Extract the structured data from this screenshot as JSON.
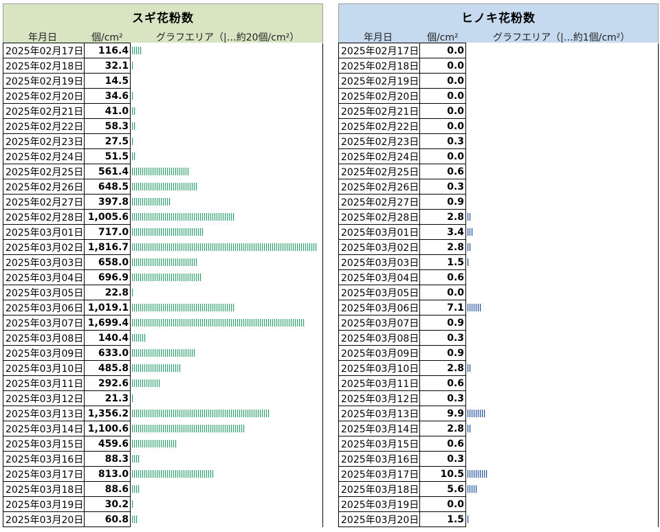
{
  "left": {
    "title": "スギ花粉数",
    "col_date": "年月日",
    "col_value": "個/cm²",
    "col_graph": "グラフエリア（|…約20個/cm²）",
    "header_color": "#d9e5c2",
    "bar_color": "#2e9e6e"
  },
  "right": {
    "title": "ヒノキ花粉数",
    "col_date": "年月日",
    "col_value": "個/cm²",
    "col_graph": "グラフエリア（|…約1個/cm²）",
    "header_color": "#c5d9ef",
    "bar_color": "#1f4e9c"
  },
  "chart_data": [
    {
      "type": "bar",
      "title": "スギ花粉数",
      "unit": "個/cm²",
      "tick_unit": 20,
      "categories": [
        "2025年02月17日",
        "2025年02月18日",
        "2025年02月19日",
        "2025年02月20日",
        "2025年02月21日",
        "2025年02月22日",
        "2025年02月23日",
        "2025年02月24日",
        "2025年02月25日",
        "2025年02月26日",
        "2025年02月27日",
        "2025年02月28日",
        "2025年03月01日",
        "2025年03月02日",
        "2025年03月03日",
        "2025年03月04日",
        "2025年03月05日",
        "2025年03月06日",
        "2025年03月07日",
        "2025年03月08日",
        "2025年03月09日",
        "2025年03月10日",
        "2025年03月11日",
        "2025年03月12日",
        "2025年03月13日",
        "2025年03月14日",
        "2025年03月15日",
        "2025年03月16日",
        "2025年03月17日",
        "2025年03月18日",
        "2025年03月19日",
        "2025年03月20日"
      ],
      "values": [
        116.4,
        32.1,
        14.5,
        34.6,
        41.0,
        58.3,
        27.5,
        51.5,
        561.4,
        648.5,
        397.8,
        1005.6,
        717.0,
        1816.7,
        658.0,
        696.9,
        22.8,
        1019.1,
        1699.4,
        140.4,
        633.0,
        485.8,
        292.6,
        21.3,
        1356.2,
        1100.6,
        459.6,
        88.3,
        813.0,
        88.6,
        30.2,
        60.8
      ],
      "labels": [
        "116.4",
        "32.1",
        "14.5",
        "34.6",
        "41.0",
        "58.3",
        "27.5",
        "51.5",
        "561.4",
        "648.5",
        "397.8",
        "1,005.6",
        "717.0",
        "1,816.7",
        "658.0",
        "696.9",
        "22.8",
        "1,019.1",
        "1,699.4",
        "140.4",
        "633.0",
        "485.8",
        "292.6",
        "21.3",
        "1,356.2",
        "1,100.6",
        "459.6",
        "88.3",
        "813.0",
        "88.6",
        "30.2",
        "60.8"
      ]
    },
    {
      "type": "bar",
      "title": "ヒノキ花粉数",
      "unit": "個/cm²",
      "tick_unit": 1,
      "categories": [
        "2025年02月17日",
        "2025年02月18日",
        "2025年02月19日",
        "2025年02月20日",
        "2025年02月21日",
        "2025年02月22日",
        "2025年02月23日",
        "2025年02月24日",
        "2025年02月25日",
        "2025年02月26日",
        "2025年02月27日",
        "2025年02月28日",
        "2025年03月01日",
        "2025年03月02日",
        "2025年03月03日",
        "2025年03月04日",
        "2025年03月05日",
        "2025年03月06日",
        "2025年03月07日",
        "2025年03月08日",
        "2025年03月09日",
        "2025年03月10日",
        "2025年03月11日",
        "2025年03月12日",
        "2025年03月13日",
        "2025年03月14日",
        "2025年03月15日",
        "2025年03月16日",
        "2025年03月17日",
        "2025年03月18日",
        "2025年03月19日",
        "2025年03月20日"
      ],
      "values": [
        0.0,
        0.0,
        0.0,
        0.0,
        0.0,
        0.0,
        0.3,
        0.0,
        0.6,
        0.3,
        0.9,
        2.8,
        3.4,
        2.8,
        1.5,
        0.6,
        0.0,
        7.1,
        0.9,
        0.3,
        0.9,
        2.8,
        0.6,
        0.3,
        9.9,
        2.8,
        0.6,
        0.3,
        10.5,
        5.6,
        0.0,
        1.5
      ],
      "labels": [
        "0.0",
        "0.0",
        "0.0",
        "0.0",
        "0.0",
        "0.0",
        "0.3",
        "0.0",
        "0.6",
        "0.3",
        "0.9",
        "2.8",
        "3.4",
        "2.8",
        "1.5",
        "0.6",
        "0.0",
        "7.1",
        "0.9",
        "0.3",
        "0.9",
        "2.8",
        "0.6",
        "0.3",
        "9.9",
        "2.8",
        "0.6",
        "0.3",
        "10.5",
        "5.6",
        "0.0",
        "1.5"
      ]
    }
  ]
}
